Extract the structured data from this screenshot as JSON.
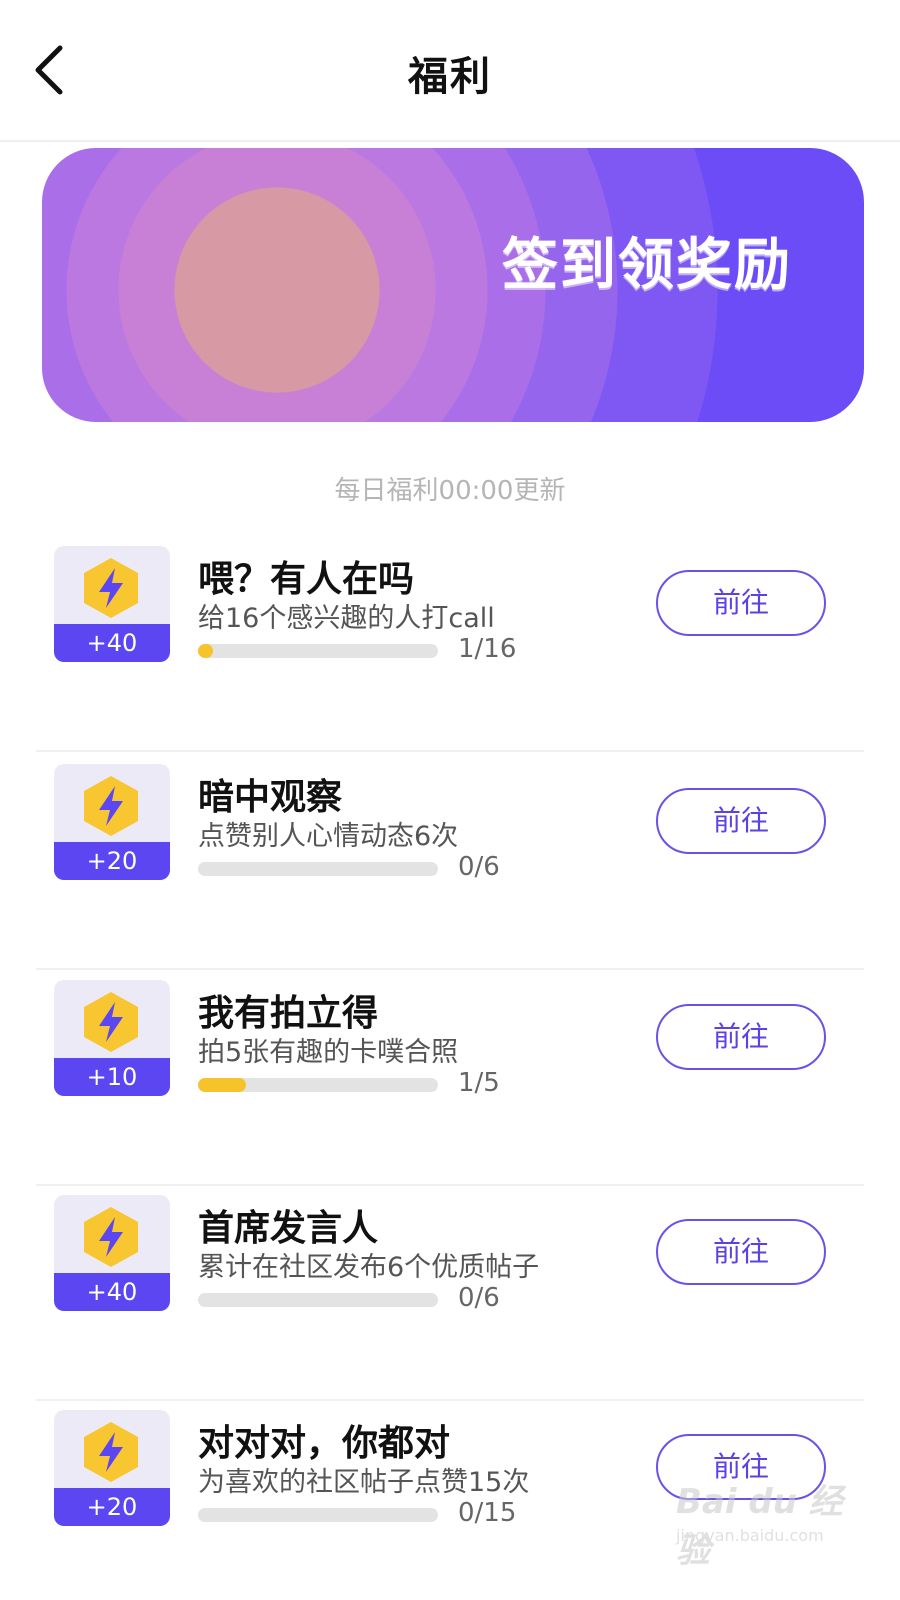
{
  "header": {
    "title": "福利",
    "back_icon": "chevron-left-icon"
  },
  "banner": {
    "title": "签到领奖励",
    "colors": {
      "start": "#d79aa4",
      "end": "#6b4cf6"
    }
  },
  "daily_note": "每日福利00:00更新",
  "tasks": [
    {
      "title": "喂？有人在吗",
      "description": "给16个感兴趣的人打call",
      "points": "+40",
      "progress_text": "1/16",
      "progress": 0.0625,
      "button_label": "前往",
      "icon": "lightning-hexagon-icon"
    },
    {
      "title": "暗中观察",
      "description": "点赞别人心情动态6次",
      "points": "+20",
      "progress_text": "0/6",
      "progress": 0,
      "button_label": "前往",
      "icon": "lightning-hexagon-icon"
    },
    {
      "title": "我有拍立得",
      "description": "拍5张有趣的卡噗合照",
      "points": "+10",
      "progress_text": "1/5",
      "progress": 0.2,
      "button_label": "前往",
      "icon": "lightning-hexagon-icon"
    },
    {
      "title": "首席发言人",
      "description": "累计在社区发布6个优质帖子",
      "points": "+40",
      "progress_text": "0/6",
      "progress": 0,
      "button_label": "前往",
      "icon": "lightning-hexagon-icon"
    },
    {
      "title": "对对对，你都对",
      "description": "为喜欢的社区帖子点赞15次",
      "points": "+20",
      "progress_text": "0/15",
      "progress": 0,
      "button_label": "前往",
      "icon": "lightning-hexagon-icon"
    }
  ],
  "colors": {
    "accent": "#5b46f2",
    "progress": "#f6c42a",
    "badge_bg": "#edeaf8"
  },
  "watermark": {
    "main": "Bai du 经验",
    "sub": "jingyan.baidu.com"
  }
}
